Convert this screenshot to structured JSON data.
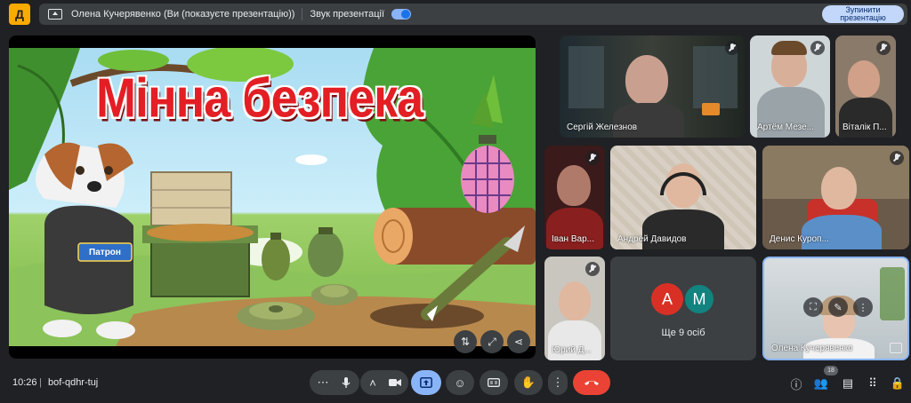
{
  "app": {
    "logo_glyph": "Д"
  },
  "present_bar": {
    "presenter_text": "Олена Кучерявенко (Ви (показуєте презентацію))",
    "audio_label": "Звук презентації",
    "audio_enabled": true,
    "stop_button": "Зупинити презентацію"
  },
  "slide": {
    "title": "Мінна безпека",
    "vest_label": "Патрон"
  },
  "stage_controls": [
    {
      "icon": "swap-icon",
      "glyph": "⇅"
    },
    {
      "icon": "expand-icon",
      "glyph": "⤢"
    },
    {
      "icon": "share-icon",
      "glyph": "⋖"
    }
  ],
  "participants": [
    {
      "name": "Сергій Железнов",
      "muted": true
    },
    {
      "name": "Артём Мезе...",
      "muted": true
    },
    {
      "name": "Віталік П...",
      "muted": true
    },
    {
      "name": "Іван Вар...",
      "muted": true
    },
    {
      "name": "Андрей Давидов",
      "muted": false
    },
    {
      "name": "Денис Куроп...",
      "muted": true
    },
    {
      "name": "Юрий Д...",
      "muted": true
    },
    {
      "name": "Олена Кучерявенко",
      "muted": false
    }
  ],
  "others": {
    "avatars": [
      {
        "letter": "А",
        "color": "#d93025"
      },
      {
        "letter": "М",
        "color": "#12837e"
      }
    ],
    "label": "Ще 9 осіб"
  },
  "bottom": {
    "time": "10:26",
    "meeting_code": "bof-qdhr-tuj",
    "participant_count": "18"
  },
  "colors": {
    "accent": "#8ab4f8",
    "end_call": "#ea4335",
    "surface": "#3c4043",
    "background": "#202124"
  }
}
